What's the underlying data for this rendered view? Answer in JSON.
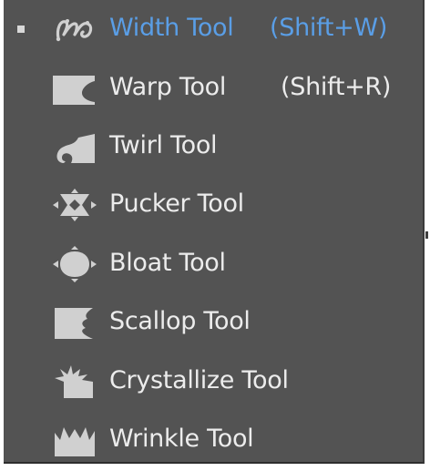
{
  "menu": {
    "items": [
      {
        "label": "Width Tool",
        "shortcut": "(Shift+W)",
        "icon": "width-tool-icon",
        "selected": true
      },
      {
        "label": "Warp Tool",
        "shortcut": "(Shift+R)",
        "icon": "warp-tool-icon",
        "selected": false
      },
      {
        "label": "Twirl Tool",
        "shortcut": "",
        "icon": "twirl-tool-icon",
        "selected": false
      },
      {
        "label": "Pucker Tool",
        "shortcut": "",
        "icon": "pucker-tool-icon",
        "selected": false
      },
      {
        "label": "Bloat Tool",
        "shortcut": "",
        "icon": "bloat-tool-icon",
        "selected": false
      },
      {
        "label": "Scallop Tool",
        "shortcut": "",
        "icon": "scallop-tool-icon",
        "selected": false
      },
      {
        "label": "Crystallize Tool",
        "shortcut": "",
        "icon": "crystallize-tool-icon",
        "selected": false
      },
      {
        "label": "Wrinkle Tool",
        "shortcut": "",
        "icon": "wrinkle-tool-icon",
        "selected": false
      }
    ]
  },
  "colors": {
    "panel_bg": "#535353",
    "text": "#ececec",
    "selected_text": "#5a9ee6",
    "icon_fill": "#d0d0d0"
  }
}
